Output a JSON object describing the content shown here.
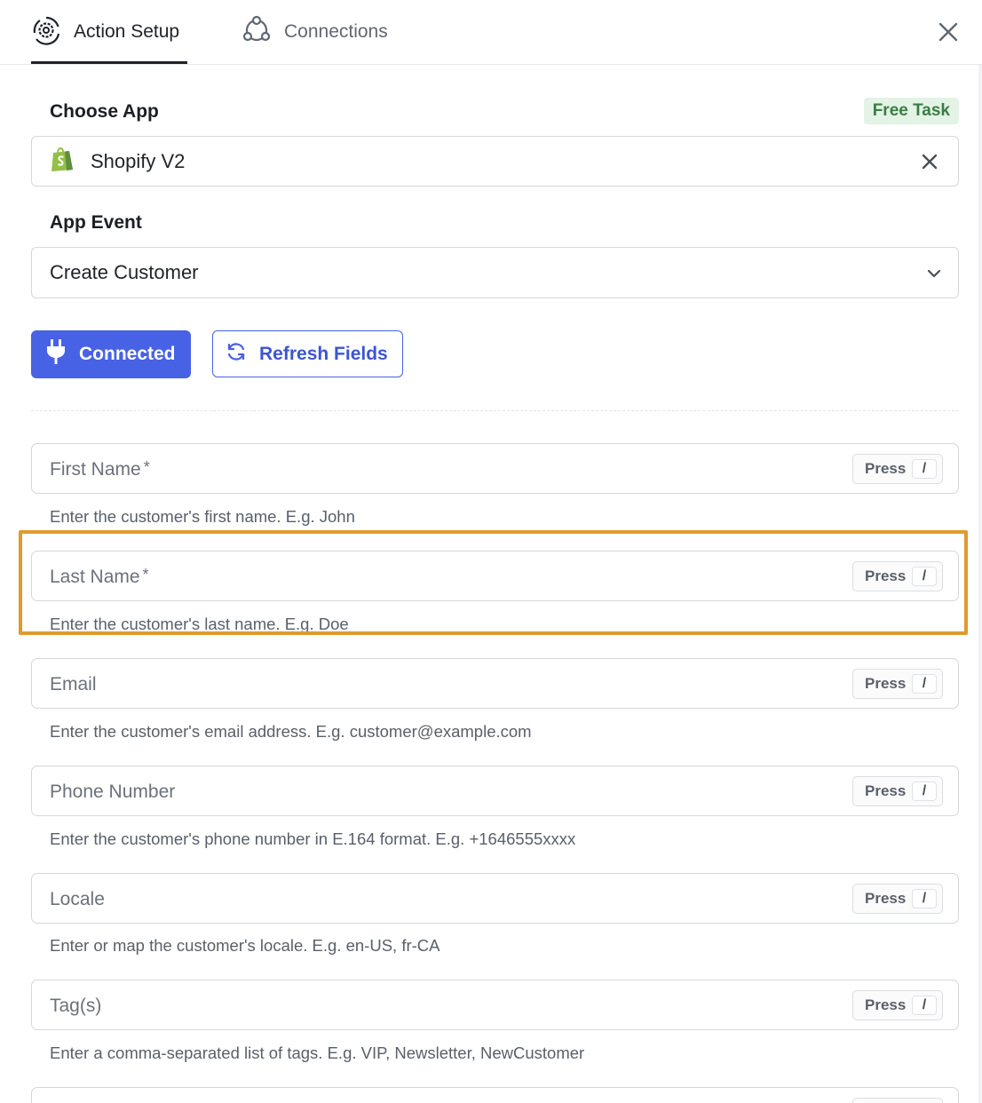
{
  "header": {
    "tabs": [
      {
        "label": "Action Setup",
        "icon": "gear-cycle-icon",
        "active": true
      },
      {
        "label": "Connections",
        "icon": "network-icon",
        "active": false
      }
    ],
    "close_icon": "close-icon"
  },
  "choose_app": {
    "label": "Choose App",
    "badge": "Free Task",
    "selected_app": "Shopify V2",
    "app_icon": "shopify-bag-icon"
  },
  "app_event": {
    "label": "App Event",
    "selected": "Create Customer"
  },
  "buttons": {
    "connected": "Connected",
    "refresh": "Refresh Fields"
  },
  "press_hint": {
    "press": "Press",
    "key": "/"
  },
  "fields": [
    {
      "label": "First Name",
      "required": "*",
      "help": "Enter the customer's first name. E.g. John"
    },
    {
      "label": "Last Name",
      "required": "*",
      "help": "Enter the customer's last name. E.g. Doe"
    },
    {
      "label": "Email",
      "required": "",
      "help": "Enter the customer's email address. E.g. customer@example.com"
    },
    {
      "label": "Phone Number",
      "required": "",
      "help": "Enter the customer's phone number in E.164 format. E.g. +1646555xxxx"
    },
    {
      "label": "Locale",
      "required": "",
      "help": "Enter or map the customer's locale. E.g. en-US, fr-CA"
    },
    {
      "label": "Tag(s)",
      "required": "",
      "help": "Enter a comma-separated list of tags. E.g. VIP, Newsletter, NewCustomer"
    }
  ],
  "colors": {
    "primary": "#4762e5",
    "highlight": "#df9a2f",
    "badge_bg": "#e3f3e5",
    "badge_text": "#3b7d45"
  }
}
